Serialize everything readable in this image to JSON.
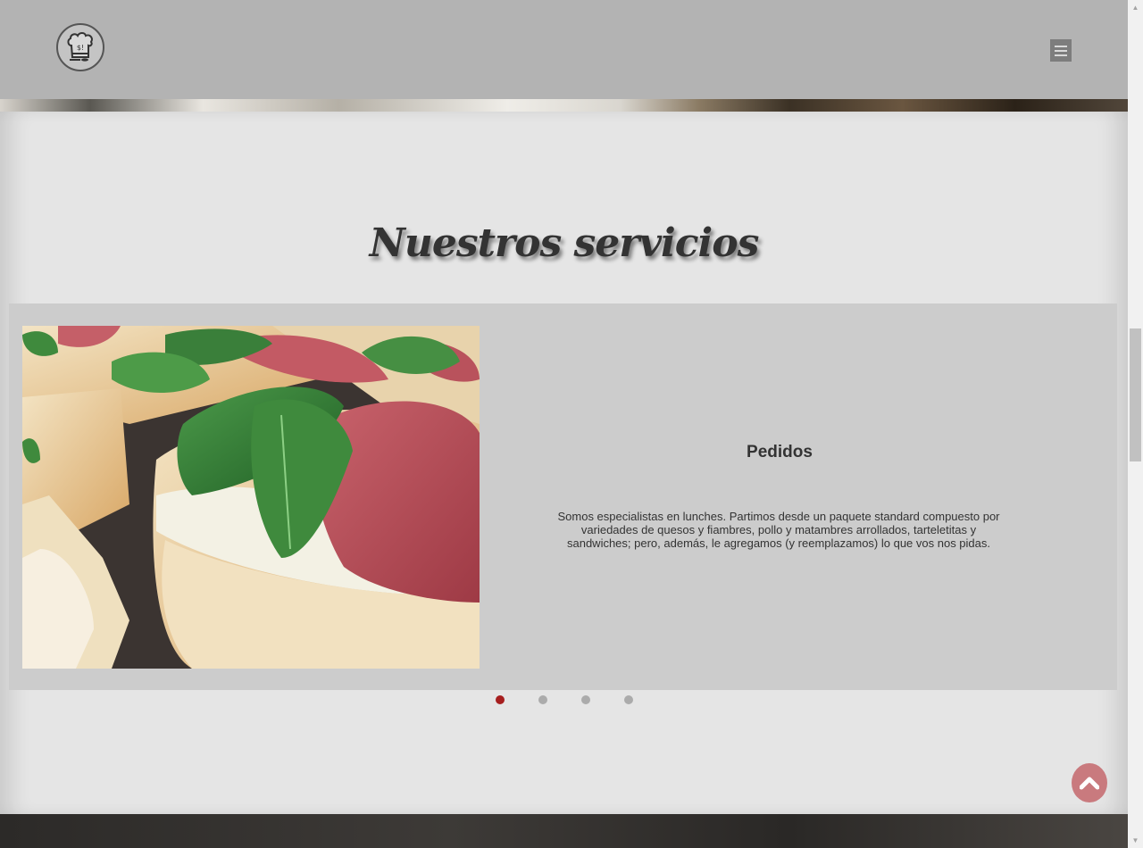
{
  "header": {
    "logo_text": "$!",
    "menu_icon": "hamburger-icon"
  },
  "section": {
    "title": "Nuestros servicios"
  },
  "slider": {
    "current_slide": 1,
    "total_slides": 4,
    "heading": "Pedidos",
    "text": "Somos especialistas en lunches. Partimos desde un paquete standard compuesto por variedades de quesos y fiambres, pollo y matambres arrollados, tarteletitas y sandwiches; pero, además, le agregamos (y reemplazamos) lo que vos nos pidas.",
    "image_icon": "food-photo"
  },
  "scroll_top": {
    "icon": "chevron-up-icon"
  },
  "colors": {
    "header_bg": "#b3b3b3",
    "section_bg": "#e5e5e5",
    "panel_bg": "#cccccc",
    "dot_active": "#a61e1e",
    "dot_inactive": "#ababab",
    "scroll_top_bg": "#c97a7e"
  }
}
